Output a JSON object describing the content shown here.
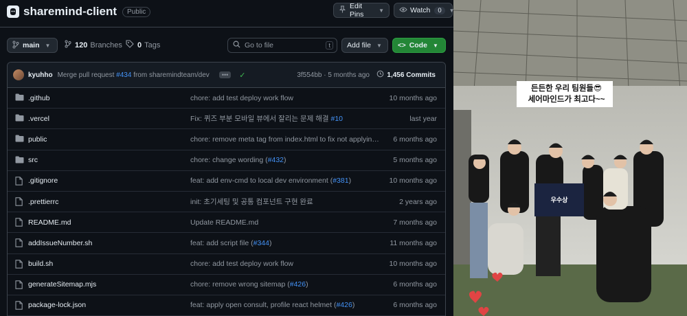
{
  "repo": {
    "name": "sharemind-client",
    "visibility": "Public"
  },
  "header_buttons": {
    "edit_pins": "Edit Pins",
    "watch": "Watch",
    "watch_count": "0"
  },
  "branch": {
    "current": "main",
    "branches_count": "120",
    "branches_label": "Branches",
    "tags_count": "0",
    "tags_label": "Tags"
  },
  "search": {
    "placeholder": "Go to file",
    "shortcut": "t"
  },
  "actions": {
    "add_file": "Add file",
    "code": "Code"
  },
  "last_commit": {
    "author": "kyuhho",
    "message_prefix": "Merge pull request ",
    "pr": "#434",
    "message_suffix": " from sharemindteam/dev",
    "sha": "3f554bb",
    "sep": " · ",
    "time": "5 months ago",
    "commits": "1,456 Commits"
  },
  "files": [
    {
      "type": "dir",
      "name": ".github",
      "msg": "chore: add test deploy work flow",
      "ref": "",
      "msg_end": "",
      "time": "10 months ago"
    },
    {
      "type": "dir",
      "name": ".vercel",
      "msg": "Fix: 퀴즈 부분 모바일 뷰에서 잘리는 문제 해결 ",
      "ref": "#10",
      "msg_end": "",
      "time": "last year"
    },
    {
      "type": "dir",
      "name": "public",
      "msg": "chore: remove meta tag from index.html to fix not applying...",
      "ref": "",
      "msg_end": "",
      "time": "6 months ago"
    },
    {
      "type": "dir",
      "name": "src",
      "msg": "chore: change wording (",
      "ref": "#432",
      "msg_end": ")",
      "time": "5 months ago"
    },
    {
      "type": "file",
      "name": ".gitignore",
      "msg": "feat: add env-cmd to local dev environment (",
      "ref": "#381",
      "msg_end": ")",
      "time": "10 months ago"
    },
    {
      "type": "file",
      "name": ".prettierrc",
      "msg": "init: 초기세팅 및 공통 컴포넌트 구현 완료",
      "ref": "",
      "msg_end": "",
      "time": "2 years ago"
    },
    {
      "type": "file",
      "name": "README.md",
      "msg": "Update README.md",
      "ref": "",
      "msg_end": "",
      "time": "7 months ago"
    },
    {
      "type": "file",
      "name": "addIssueNumber.sh",
      "msg": "feat: add script file (",
      "ref": "#344",
      "msg_end": ")",
      "time": "11 months ago"
    },
    {
      "type": "file",
      "name": "build.sh",
      "msg": "chore: add test deploy work flow",
      "ref": "",
      "msg_end": "",
      "time": "10 months ago"
    },
    {
      "type": "file",
      "name": "generateSitemap.mjs",
      "msg": "chore: remove wrong sitemap (",
      "ref": "#426",
      "msg_end": ")",
      "time": "6 months ago"
    },
    {
      "type": "file",
      "name": "package-lock.json",
      "msg": "feat: apply open consult, profile react helmet (",
      "ref": "#426",
      "msg_end": ")",
      "time": "6 months ago"
    }
  ],
  "photo": {
    "caption_line1": "든든한 우리 팀원들😎",
    "caption_line2": "세어마인드가 최고다~~",
    "sign_text": "우수상"
  },
  "colors": {
    "accent_blue": "#4493f8",
    "code_button": "#238636",
    "bg": "#0d1117",
    "border": "#3d444d",
    "muted": "#9198a1"
  }
}
